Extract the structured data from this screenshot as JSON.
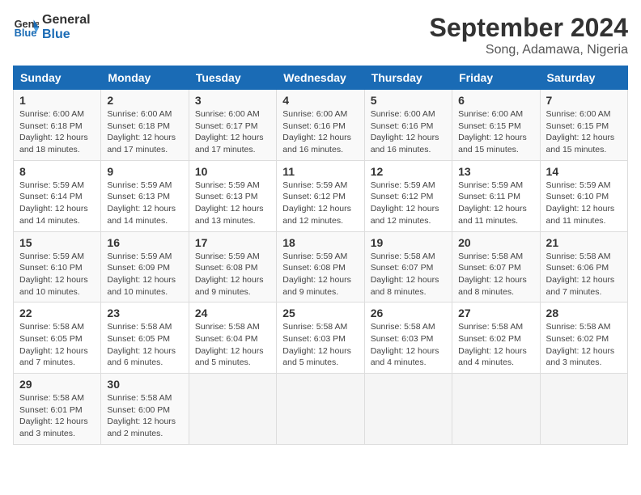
{
  "logo": {
    "line1": "General",
    "line2": "Blue"
  },
  "title": "September 2024",
  "subtitle": "Song, Adamawa, Nigeria",
  "days_of_week": [
    "Sunday",
    "Monday",
    "Tuesday",
    "Wednesday",
    "Thursday",
    "Friday",
    "Saturday"
  ],
  "weeks": [
    [
      {
        "day": "1",
        "sunrise": "6:00 AM",
        "sunset": "6:18 PM",
        "daylight": "12 hours and 18 minutes."
      },
      {
        "day": "2",
        "sunrise": "6:00 AM",
        "sunset": "6:18 PM",
        "daylight": "12 hours and 17 minutes."
      },
      {
        "day": "3",
        "sunrise": "6:00 AM",
        "sunset": "6:17 PM",
        "daylight": "12 hours and 17 minutes."
      },
      {
        "day": "4",
        "sunrise": "6:00 AM",
        "sunset": "6:16 PM",
        "daylight": "12 hours and 16 minutes."
      },
      {
        "day": "5",
        "sunrise": "6:00 AM",
        "sunset": "6:16 PM",
        "daylight": "12 hours and 16 minutes."
      },
      {
        "day": "6",
        "sunrise": "6:00 AM",
        "sunset": "6:15 PM",
        "daylight": "12 hours and 15 minutes."
      },
      {
        "day": "7",
        "sunrise": "6:00 AM",
        "sunset": "6:15 PM",
        "daylight": "12 hours and 15 minutes."
      }
    ],
    [
      {
        "day": "8",
        "sunrise": "5:59 AM",
        "sunset": "6:14 PM",
        "daylight": "12 hours and 14 minutes."
      },
      {
        "day": "9",
        "sunrise": "5:59 AM",
        "sunset": "6:13 PM",
        "daylight": "12 hours and 14 minutes."
      },
      {
        "day": "10",
        "sunrise": "5:59 AM",
        "sunset": "6:13 PM",
        "daylight": "12 hours and 13 minutes."
      },
      {
        "day": "11",
        "sunrise": "5:59 AM",
        "sunset": "6:12 PM",
        "daylight": "12 hours and 12 minutes."
      },
      {
        "day": "12",
        "sunrise": "5:59 AM",
        "sunset": "6:12 PM",
        "daylight": "12 hours and 12 minutes."
      },
      {
        "day": "13",
        "sunrise": "5:59 AM",
        "sunset": "6:11 PM",
        "daylight": "12 hours and 11 minutes."
      },
      {
        "day": "14",
        "sunrise": "5:59 AM",
        "sunset": "6:10 PM",
        "daylight": "12 hours and 11 minutes."
      }
    ],
    [
      {
        "day": "15",
        "sunrise": "5:59 AM",
        "sunset": "6:10 PM",
        "daylight": "12 hours and 10 minutes."
      },
      {
        "day": "16",
        "sunrise": "5:59 AM",
        "sunset": "6:09 PM",
        "daylight": "12 hours and 10 minutes."
      },
      {
        "day": "17",
        "sunrise": "5:59 AM",
        "sunset": "6:08 PM",
        "daylight": "12 hours and 9 minutes."
      },
      {
        "day": "18",
        "sunrise": "5:59 AM",
        "sunset": "6:08 PM",
        "daylight": "12 hours and 9 minutes."
      },
      {
        "day": "19",
        "sunrise": "5:58 AM",
        "sunset": "6:07 PM",
        "daylight": "12 hours and 8 minutes."
      },
      {
        "day": "20",
        "sunrise": "5:58 AM",
        "sunset": "6:07 PM",
        "daylight": "12 hours and 8 minutes."
      },
      {
        "day": "21",
        "sunrise": "5:58 AM",
        "sunset": "6:06 PM",
        "daylight": "12 hours and 7 minutes."
      }
    ],
    [
      {
        "day": "22",
        "sunrise": "5:58 AM",
        "sunset": "6:05 PM",
        "daylight": "12 hours and 7 minutes."
      },
      {
        "day": "23",
        "sunrise": "5:58 AM",
        "sunset": "6:05 PM",
        "daylight": "12 hours and 6 minutes."
      },
      {
        "day": "24",
        "sunrise": "5:58 AM",
        "sunset": "6:04 PM",
        "daylight": "12 hours and 5 minutes."
      },
      {
        "day": "25",
        "sunrise": "5:58 AM",
        "sunset": "6:03 PM",
        "daylight": "12 hours and 5 minutes."
      },
      {
        "day": "26",
        "sunrise": "5:58 AM",
        "sunset": "6:03 PM",
        "daylight": "12 hours and 4 minutes."
      },
      {
        "day": "27",
        "sunrise": "5:58 AM",
        "sunset": "6:02 PM",
        "daylight": "12 hours and 4 minutes."
      },
      {
        "day": "28",
        "sunrise": "5:58 AM",
        "sunset": "6:02 PM",
        "daylight": "12 hours and 3 minutes."
      }
    ],
    [
      {
        "day": "29",
        "sunrise": "5:58 AM",
        "sunset": "6:01 PM",
        "daylight": "12 hours and 3 minutes."
      },
      {
        "day": "30",
        "sunrise": "5:58 AM",
        "sunset": "6:00 PM",
        "daylight": "12 hours and 2 minutes."
      },
      null,
      null,
      null,
      null,
      null
    ]
  ]
}
